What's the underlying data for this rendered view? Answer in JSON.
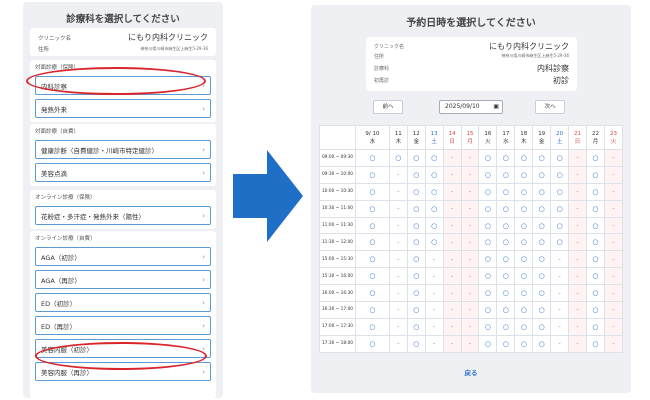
{
  "left": {
    "title": "診療科を選択してください",
    "clinic_label": "クリニック名",
    "clinic_name": "にもり内科クリニック",
    "address_label": "住所",
    "address": "神奈川県川崎市麻生区上麻生5-29-36",
    "sections": [
      {
        "title": "対面診療（保険）",
        "items": [
          "内科診察",
          "発熱外来"
        ]
      },
      {
        "title": "対面診療（自費）",
        "items": [
          "健康診断（自費健診・川崎市特定健診）",
          "美容点滴"
        ]
      },
      {
        "title": "オンライン診療（保険）",
        "items": [
          "花粉症・多汗症・発熱外来（陽性）"
        ]
      },
      {
        "title": "オンライン診療（自費）",
        "items": [
          "AGA（初診）",
          "AGA（再診）",
          "ED（初診）",
          "ED（再診）",
          "美容内服（初診）",
          "美容内服（再診）"
        ]
      }
    ]
  },
  "right": {
    "title": "予約日時を選択してください",
    "rows": [
      {
        "label": "クリニック名",
        "value": "にもり内科クリニック"
      },
      {
        "label": "住所",
        "value": "神奈川県川崎市麻生区上麻生5-29-36"
      },
      {
        "label": "診療科",
        "value": "内科診察"
      },
      {
        "label": "初再診",
        "value": "初診"
      }
    ],
    "prev": "前へ",
    "next": "次へ",
    "date": "2025/09/10",
    "back": "戻る"
  },
  "calendar": {
    "days": [
      {
        "date": "9/ 10",
        "dow": "水",
        "type": "weekday"
      },
      {
        "date": "11",
        "dow": "木",
        "type": "weekday"
      },
      {
        "date": "12",
        "dow": "金",
        "type": "weekday"
      },
      {
        "date": "13",
        "dow": "土",
        "type": "sat"
      },
      {
        "date": "14",
        "dow": "日",
        "type": "sun"
      },
      {
        "date": "15",
        "dow": "月",
        "type": "sun"
      },
      {
        "date": "16",
        "dow": "火",
        "type": "weekday"
      },
      {
        "date": "17",
        "dow": "水",
        "type": "weekday"
      },
      {
        "date": "18",
        "dow": "木",
        "type": "weekday"
      },
      {
        "date": "19",
        "dow": "金",
        "type": "weekday"
      },
      {
        "date": "20",
        "dow": "土",
        "type": "sat"
      },
      {
        "date": "21",
        "dow": "日",
        "type": "sun"
      },
      {
        "date": "22",
        "dow": "月",
        "type": "weekday"
      },
      {
        "date": "23",
        "dow": "火",
        "type": "sun"
      }
    ],
    "times": [
      "09:00 ~ 09:30",
      "09:30 ~ 10:00",
      "10:00 ~ 10:30",
      "10:30 ~ 11:00",
      "11:00 ~ 11:30",
      "11:30 ~ 12:00",
      "15:00 ~ 15:30",
      "15:30 ~ 16:00",
      "16:00 ~ 16:30",
      "16:30 ~ 17:00",
      "17:00 ~ 17:30",
      "17:30 ~ 18:00"
    ],
    "slots": [
      [
        "○",
        "○",
        "○",
        "○",
        "-",
        "-",
        "○",
        "○",
        "○",
        "○",
        "○",
        "-",
        "○",
        "-"
      ],
      [
        "○",
        "-",
        "○",
        "○",
        "-",
        "-",
        "○",
        "○",
        "○",
        "○",
        "○",
        "-",
        "○",
        "-"
      ],
      [
        "○",
        "-",
        "○",
        "○",
        "-",
        "-",
        "○",
        "○",
        "○",
        "○",
        "○",
        "-",
        "○",
        "-"
      ],
      [
        "○",
        "-",
        "○",
        "○",
        "-",
        "-",
        "○",
        "○",
        "○",
        "○",
        "○",
        "-",
        "○",
        "-"
      ],
      [
        "○",
        "-",
        "○",
        "○",
        "-",
        "-",
        "○",
        "○",
        "○",
        "○",
        "○",
        "-",
        "○",
        "-"
      ],
      [
        "○",
        "-",
        "○",
        "○",
        "-",
        "-",
        "○",
        "○",
        "○",
        "○",
        "○",
        "-",
        "○",
        "-"
      ],
      [
        "○",
        "-",
        "○",
        "-",
        "-",
        "-",
        "○",
        "○",
        "○",
        "○",
        "-",
        "-",
        "○",
        "-"
      ],
      [
        "○",
        "-",
        "○",
        "-",
        "-",
        "-",
        "○",
        "○",
        "○",
        "○",
        "-",
        "-",
        "○",
        "-"
      ],
      [
        "○",
        "-",
        "○",
        "-",
        "-",
        "-",
        "○",
        "○",
        "○",
        "○",
        "-",
        "-",
        "○",
        "-"
      ],
      [
        "○",
        "-",
        "○",
        "-",
        "-",
        "-",
        "○",
        "○",
        "○",
        "○",
        "-",
        "-",
        "○",
        "-"
      ],
      [
        "○",
        "-",
        "○",
        "-",
        "-",
        "-",
        "○",
        "○",
        "○",
        "○",
        "-",
        "-",
        "○",
        "-"
      ],
      [
        "○",
        "-",
        "○",
        "-",
        "-",
        "-",
        "○",
        "○",
        "○",
        "○",
        "-",
        "-",
        "○",
        "-"
      ]
    ]
  },
  "colors": {
    "accent": "#2a6fd1",
    "highlight_oval": "#d9262c",
    "arrow": "#1f6fc6"
  },
  "icons": {
    "arrow": "right-arrow-icon",
    "chevron": "chevron-right-icon",
    "calendar": "calendar-icon"
  }
}
